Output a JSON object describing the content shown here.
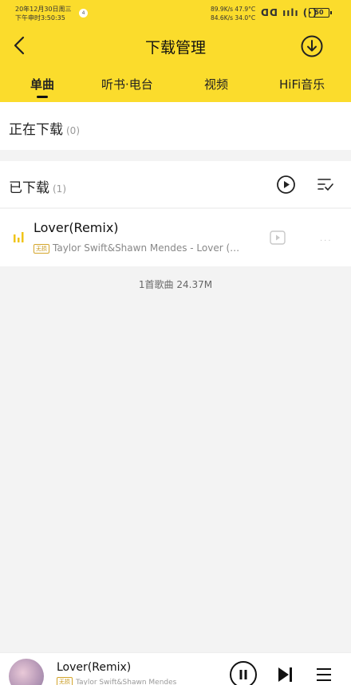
{
  "status_bar": {
    "date": "20年12月30日周三",
    "time": "下午申时3:50:35",
    "badge": "4",
    "net_up": "89.9K/s 47.9°C",
    "net_down": "84.6K/s 34.0°C",
    "icons": "ᗡᗡ ıılı (·)",
    "battery": "50"
  },
  "header": {
    "title": "下载管理",
    "tabs": [
      {
        "label": "单曲"
      },
      {
        "label": "听书·电台"
      },
      {
        "label": "视频"
      },
      {
        "label": "HiFi音乐"
      }
    ]
  },
  "downloading": {
    "title": "正在下载",
    "count": "(0)"
  },
  "downloaded": {
    "title": "已下载",
    "count": "(1)",
    "songs": [
      {
        "title": "Lover(Remix)",
        "tag": "无损",
        "subtitle": "Taylor Swift&Shawn Mendes - Lover (…",
        "more": "···"
      }
    ],
    "summary": "1首歌曲 24.37M"
  },
  "player": {
    "title": "Lover(Remix)",
    "tag": "无损",
    "subtitle": "Taylor Swift&Shawn Mendes"
  },
  "colors": {
    "accent": "#fbdc2c",
    "playing_bars": "#f0c419"
  }
}
